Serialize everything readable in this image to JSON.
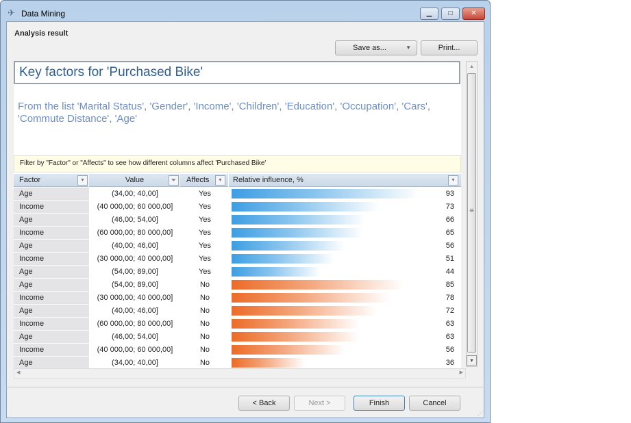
{
  "window": {
    "title": "Data Mining",
    "minimize": "▁",
    "maximize": "□",
    "close": "✕"
  },
  "header": "Analysis result",
  "toolbar": {
    "save_as": "Save as...",
    "print": "Print..."
  },
  "key_title": "Key factors for 'Purchased Bike'",
  "subtitle": "From the list 'Marital Status', 'Gender', 'Income', 'Children', 'Education', 'Occupation', 'Cars', 'Commute Distance', 'Age'",
  "filter_hint": "Filter by \"Factor\" or \"Affects\" to see how different columns affect 'Purchased Bike'",
  "columns": [
    "Factor",
    "Value",
    "Affects",
    "Relative influence, %"
  ],
  "colors": {
    "yes": "#3d9ee3",
    "no": "#ec6b27"
  },
  "rows": [
    {
      "factor": "Age",
      "value": "(34,00; 40,00]",
      "affects": "Yes",
      "influence": 93
    },
    {
      "factor": "Income",
      "value": "(40 000,00; 60 000,00]",
      "affects": "Yes",
      "influence": 73
    },
    {
      "factor": "Age",
      "value": "(46,00; 54,00]",
      "affects": "Yes",
      "influence": 66
    },
    {
      "factor": "Income",
      "value": "(60 000,00; 80 000,00]",
      "affects": "Yes",
      "influence": 65
    },
    {
      "factor": "Age",
      "value": "(40,00; 46,00]",
      "affects": "Yes",
      "influence": 56
    },
    {
      "factor": "Income",
      "value": "(30 000,00; 40 000,00]",
      "affects": "Yes",
      "influence": 51
    },
    {
      "factor": "Age",
      "value": "(54,00; 89,00]",
      "affects": "Yes",
      "influence": 44
    },
    {
      "factor": "Age",
      "value": "(54,00; 89,00]",
      "affects": "No",
      "influence": 85
    },
    {
      "factor": "Income",
      "value": "(30 000,00; 40 000,00]",
      "affects": "No",
      "influence": 78
    },
    {
      "factor": "Age",
      "value": "(40,00; 46,00]",
      "affects": "No",
      "influence": 72
    },
    {
      "factor": "Income",
      "value": "(60 000,00; 80 000,00]",
      "affects": "No",
      "influence": 63
    },
    {
      "factor": "Age",
      "value": "(46,00; 54,00]",
      "affects": "No",
      "influence": 63
    },
    {
      "factor": "Income",
      "value": "(40 000,00; 60 000,00]",
      "affects": "No",
      "influence": 56
    },
    {
      "factor": "Age",
      "value": "(34,00; 40,00]",
      "affects": "No",
      "influence": 36
    }
  ],
  "footer": {
    "back": "< Back",
    "next": "Next >",
    "finish": "Finish",
    "cancel": "Cancel"
  }
}
